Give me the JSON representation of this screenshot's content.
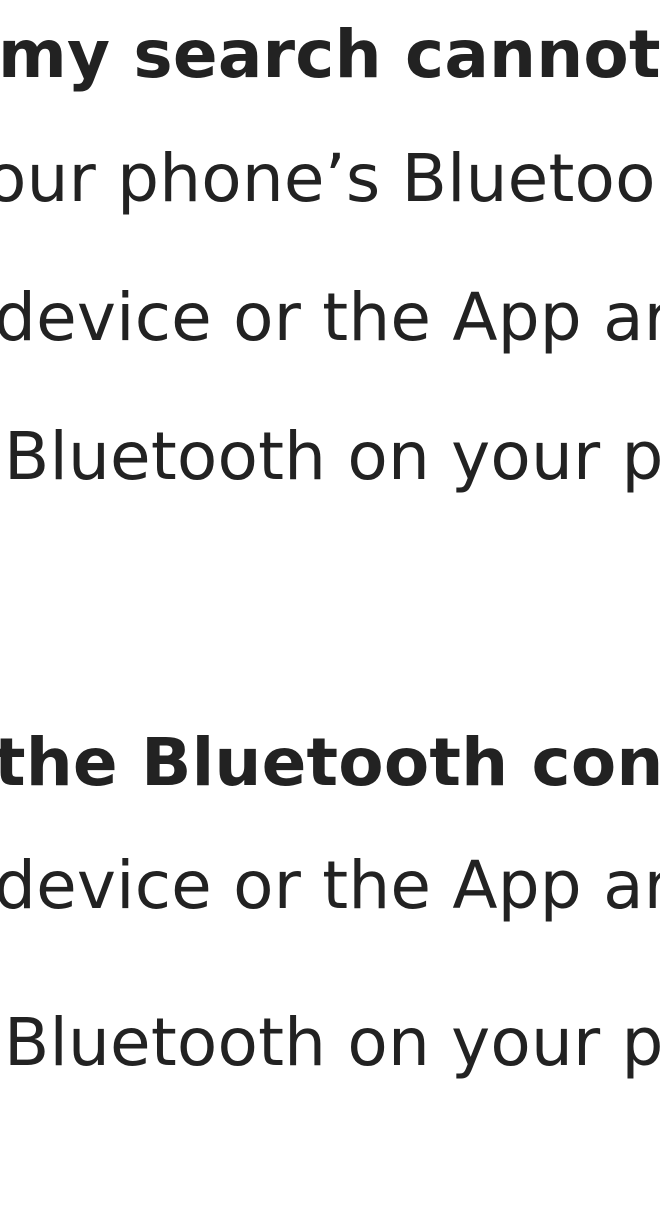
{
  "sections": [
    {
      "heading": "my search cannot fir",
      "lines": [
        "our phone’s Bluetoo",
        "device or the App ar",
        "Bluetooth on your p"
      ]
    },
    {
      "heading": "the Bluetooth conne",
      "lines": [
        "device or the App ar",
        "Bluetooth on your p"
      ]
    }
  ]
}
